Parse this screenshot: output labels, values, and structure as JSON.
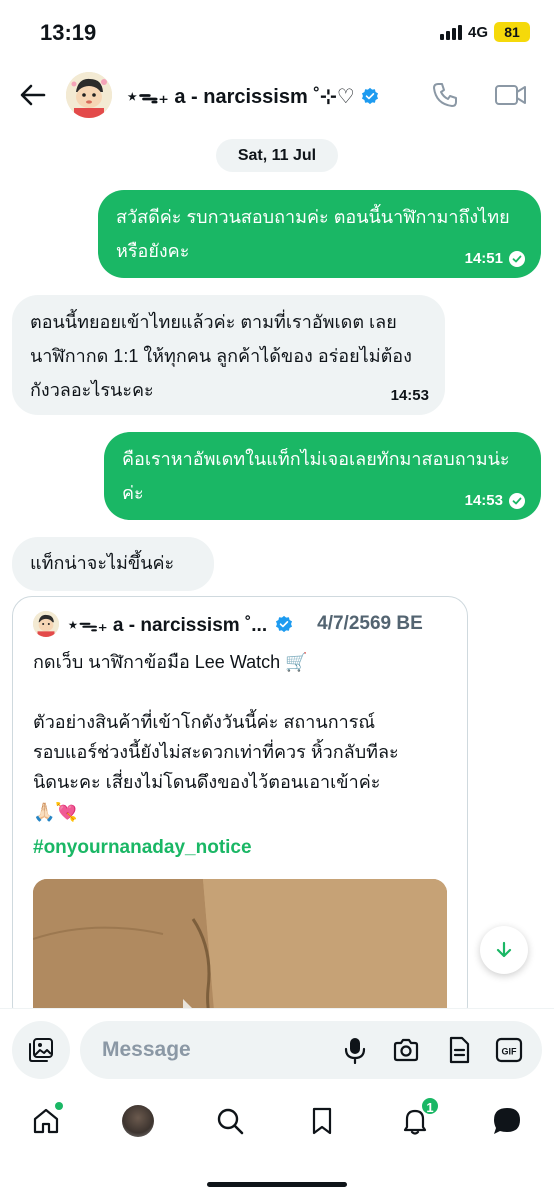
{
  "status_bar": {
    "time": "13:19",
    "network": "4G",
    "battery": "81"
  },
  "header": {
    "contact_name": "⋆ᯓ₊ a - narcissism ˚⊹♡"
  },
  "date_separator": "Sat, 11 Jul",
  "messages": [
    {
      "direction": "out",
      "text": "สวัสดีค่ะ รบกวนสอบถามค่ะ ตอนนี้นาฬิกามาถึงไทยหรือยังคะ",
      "time": "14:51"
    },
    {
      "direction": "in",
      "text": "ตอนนี้ทยอยเข้าไทยแล้วค่ะ ตามที่เราอัพเดต เลย นาฬิกากด 1:1 ให้ทุกคน ลูกค้าได้ของ อร่อยไม่ต้องกังวลอะไรนะคะ",
      "time": "14:53"
    },
    {
      "direction": "out",
      "text": "คือเราหาอัพเดทในแท็กไม่เจอเลยทักมาสอบถามน่ะค่ะ",
      "time": "14:53"
    },
    {
      "direction": "in",
      "text": "แท็กน่าจะไม่ขึ้นค่ะ",
      "time": ""
    }
  ],
  "quoted_post": {
    "author": "⋆ᯓ₊ a - narcissism ˚...",
    "date": "4/7/2569 BE",
    "line1": "กดเว็บ นาฬิกาข้อมือ Lee Watch 🛒",
    "line2": "ตัวอย่างสินค้าที่เข้าโกดังวันนี้ค่ะ สถานการณ์",
    "line3": "รอบแอร์ช่วงนี้ยังไม่สะดวกเท่าที่ควร หิ้วกลับทีละ",
    "line4": "นิดนะคะ เสี่ยงไม่โดนดึงของไว้ตอนเอาเข้าค่ะ",
    "line5": "🙏🏻💘",
    "hashtag": "#onyournanaday_notice"
  },
  "composer": {
    "placeholder": "Message"
  },
  "tabbar": {
    "notifications_badge": "1"
  },
  "colors": {
    "accent": "#1ab765",
    "bubble_in": "#eff3f4",
    "verified": "#1d9bf0"
  }
}
